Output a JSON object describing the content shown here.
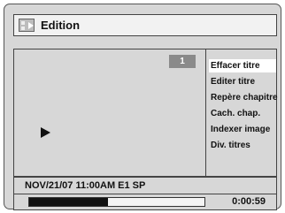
{
  "header": {
    "title": "Edition",
    "icon": "edit-film-icon"
  },
  "preview": {
    "title_number": "1",
    "state_icon": "play-icon"
  },
  "menu": {
    "items": [
      {
        "label": "Effacer titre",
        "selected": true
      },
      {
        "label": "Editer titre",
        "selected": false
      },
      {
        "label": "Repère chapitre",
        "selected": false
      },
      {
        "label": "Cach. chap.",
        "selected": false
      },
      {
        "label": "Indexer image",
        "selected": false
      },
      {
        "label": "Div. titres",
        "selected": false
      }
    ]
  },
  "status": {
    "info": "NOV/21/07 11:00AM E1 SP"
  },
  "playback": {
    "progress_fraction": 0.45,
    "time": "0:00:59"
  },
  "colors": {
    "panel": "#d7d7d7",
    "title_bar": "#f2f2f2",
    "selected_item": "#ffffff",
    "badge": "#8a8a8a",
    "progress_fill": "#111111"
  }
}
